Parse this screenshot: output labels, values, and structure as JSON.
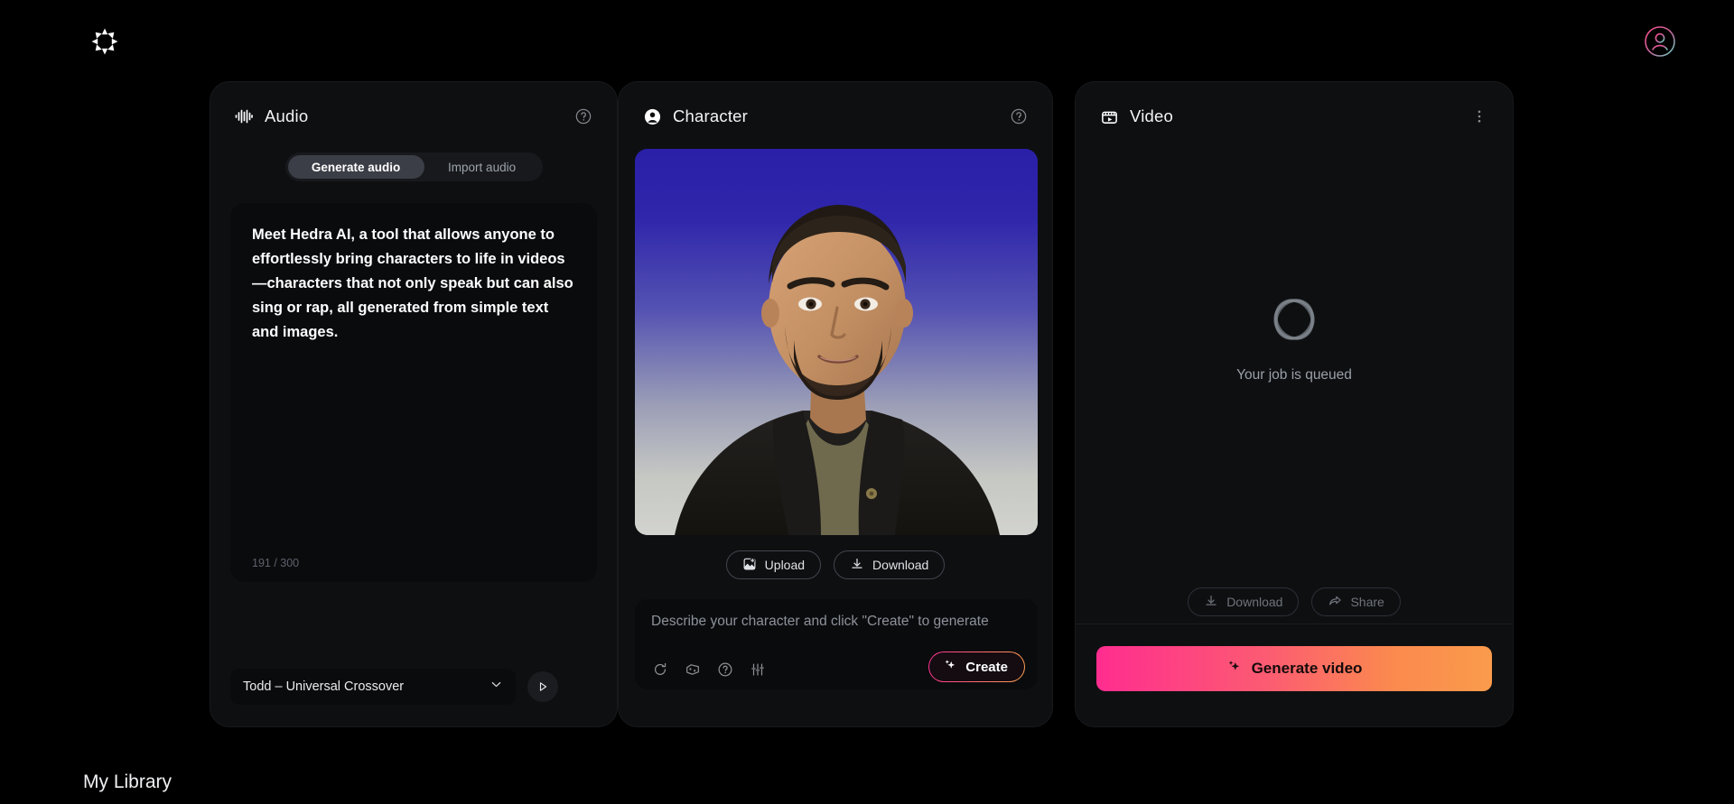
{
  "topbar": {
    "logo_icon": "hedra-asterisk-logo",
    "avatar_icon": "user-avatar-icon"
  },
  "audio_panel": {
    "title": "Audio",
    "icon": "waveform-icon",
    "help_icon": "help-circle-icon",
    "tabs": [
      {
        "label": "Generate audio",
        "active": true
      },
      {
        "label": "Import audio",
        "active": false
      }
    ],
    "script": "Meet Hedra AI, a tool that allows anyone to effortlessly bring characters to life in videos—characters that not only speak but can also sing or rap, all generated from simple text and images.",
    "char_count": "191 / 300",
    "voice": {
      "value": "Todd – Universal Crossover",
      "chevron_icon": "chevron-down-icon",
      "play_icon": "play-icon"
    }
  },
  "character_panel": {
    "title": "Character",
    "icon": "person-circle-icon",
    "help_icon": "help-circle-icon",
    "upload_label": "Upload",
    "upload_icon": "image-plus-icon",
    "download_label": "Download",
    "download_icon": "download-icon",
    "prompt_placeholder": "Describe your character and click \"Create\" to generate",
    "tools": [
      "refresh-icon",
      "dice-icon",
      "help-circle-icon",
      "sliders-icon"
    ],
    "create_label": "Create",
    "create_icon": "sparkle-icon"
  },
  "video_panel": {
    "title": "Video",
    "icon": "clapperboard-icon",
    "menu_icon": "more-vertical-icon",
    "status_text": "Your job is queued",
    "spinner_icon": "loading-orbit-icon",
    "download_label": "Download",
    "download_icon": "download-icon",
    "share_label": "Share",
    "share_icon": "share-icon",
    "generate_label": "Generate video",
    "generate_icon": "sparkle-icon"
  },
  "bottom": {
    "library_title": "My Library"
  },
  "colors": {
    "page_bg": "#000000",
    "card_bg": "#0e0f11",
    "inner_bg": "#0a0b0d",
    "accent_pink": "#ff2d8f",
    "accent_orange": "#fa9b4c",
    "active_tab": "#3b3e46"
  }
}
